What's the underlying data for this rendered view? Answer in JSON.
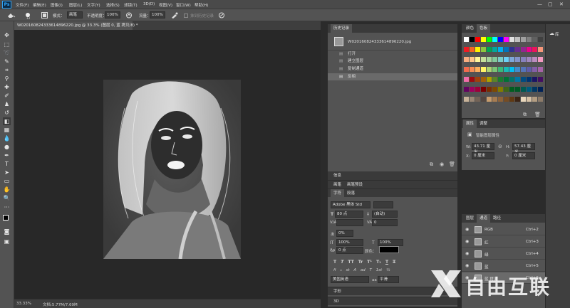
{
  "app": {
    "logo": "Ps"
  },
  "menu": [
    "文件(F)",
    "编辑(E)",
    "图像(I)",
    "图层(L)",
    "文字(Y)",
    "选择(S)",
    "滤镜(T)",
    "3D(D)",
    "视图(V)",
    "窗口(W)",
    "帮助(H)"
  ],
  "window_controls": {
    "minimize": "—",
    "restore": "▢",
    "close": "✕"
  },
  "options": {
    "mode_label": "模式：",
    "mode_value": "画笔",
    "opacity_label": "不透明度：",
    "opacity_value": "100%",
    "flow_label": "流量：",
    "flow_value": "100%",
    "erase_history": "抹到历史记录"
  },
  "document": {
    "tab_title": "W020160824333614896220.jpg @ 33.3% (图层 0, 蓝 拷贝/8) *",
    "close": "×"
  },
  "status": {
    "zoom": "33.33%",
    "doc_size": "文档:5.77M/7.69M"
  },
  "history": {
    "tab": "历史记录",
    "snapshot": "W020160824333614896220.jpg",
    "items": [
      "打开",
      "建立图层",
      "复制通道",
      "反相"
    ]
  },
  "swatches": {
    "tabs": [
      "颜色",
      "色板"
    ]
  },
  "properties": {
    "tabs": [
      "属性",
      "调整"
    ],
    "title": "智能图层属性",
    "w_label": "W:",
    "w_value": "43.71 厘米",
    "h_label": "H:",
    "h_value": "57.43 厘米",
    "x_label": "X:",
    "x_value": "0 厘米",
    "y_label": "Y:",
    "y_value": "0 厘米"
  },
  "info": {
    "tab": "信息"
  },
  "brush": {
    "tabs": [
      "画笔",
      "画笔预设"
    ]
  },
  "character": {
    "tabs": [
      "字符",
      "段落"
    ],
    "font_family": "Adobe 黑体 Std",
    "font_size": "80 点",
    "leading": "(自动)",
    "tracking": "0",
    "kerning": "",
    "scale_v": "0%",
    "vscale": "100%",
    "hscale": "100%",
    "baseline": "0 点",
    "color_label": "颜色：",
    "type_buttons": [
      "T",
      "T",
      "TT",
      "Tr",
      "T¹",
      "T₁",
      "T",
      "T"
    ],
    "ot_buttons": [
      "fi",
      "ℴ",
      "st",
      "A",
      "ad",
      "T",
      "1st",
      "½"
    ],
    "language": "美国英语",
    "aa": "aa",
    "aa_value": "平滑"
  },
  "glyph": {
    "tab": "字形"
  },
  "threed": {
    "tab": "3D"
  },
  "layers": {
    "tabs": [
      "图层",
      "通道",
      "路径"
    ],
    "rows": [
      {
        "name": "RGB",
        "shortcut": "Ctrl+2"
      },
      {
        "name": "红",
        "shortcut": "Ctrl+3"
      },
      {
        "name": "绿",
        "shortcut": "Ctrl+4"
      },
      {
        "name": "蓝",
        "shortcut": "Ctrl+5"
      },
      {
        "name": "蓝 拷贝",
        "shortcut": "Ctrl+6"
      }
    ]
  },
  "watermark": {
    "text": "自由互联"
  },
  "colors": {
    "accent": "#31a8ff",
    "ui_dark": "#3a3a3a",
    "ui_mid": "#535353",
    "canvas": "#282828"
  }
}
